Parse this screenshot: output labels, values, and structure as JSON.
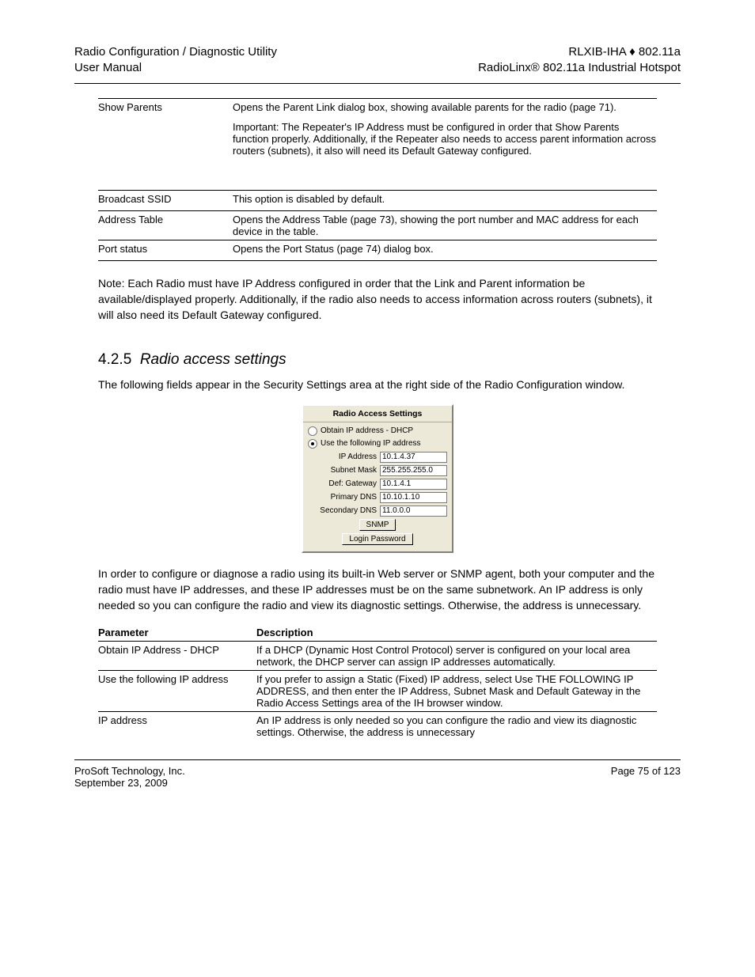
{
  "header": {
    "left_line1": "Radio Configuration / Diagnostic Utility",
    "left_line2": "User Manual",
    "right_line1": "RLXIB-IHA ♦ 802.11a",
    "right_line2": "RadioLinx® 802.11a Industrial Hotspot"
  },
  "table1": {
    "rows": [
      {
        "l": "Show Parents",
        "r": "Opens the Parent Link dialog box, showing available parents for the radio (page 71)."
      },
      {
        "l": "",
        "r": "Important: The Repeater's IP Address must be configured in order that Show Parents function properly. Additionally, if the Repeater also needs to access parent information across routers (subnets), it also will need its Default Gateway configured."
      },
      {
        "l": "Broadcast SSID",
        "r": "This option is disabled by default."
      },
      {
        "l": "Address Table",
        "r": "Opens the Address Table (page 73), showing the port number and MAC address for each device in the table."
      },
      {
        "l": "Port status",
        "r": "Opens the Port Status (page 74) dialog box."
      }
    ]
  },
  "note": "Note: Each Radio must have IP Address configured in order that the Link and Parent information be available/displayed properly. Additionally, if the radio also needs to access information across routers (subnets), it will also need its Default Gateway configured.",
  "section": {
    "number": "4.2.5",
    "title": "Radio access settings"
  },
  "body": "The following fields appear in the Security Settings area at the right side of the Radio Configuration window.",
  "dialog": {
    "title": "Radio Access Settings",
    "radio1": "Obtain IP address - DHCP",
    "radio2": "Use the following IP address",
    "fields": [
      {
        "label": "IP Address",
        "value": "10.1.4.37"
      },
      {
        "label": "Subnet Mask",
        "value": "255.255.255.0"
      },
      {
        "label": "Def: Gateway",
        "value": "10.1.4.1"
      },
      {
        "label": "Primary DNS",
        "value": "10.10.1.10"
      },
      {
        "label": "Secondary DNS",
        "value": "11.0.0.0"
      }
    ],
    "btn_snmp": "SNMP",
    "btn_login": "Login Password"
  },
  "body2": "In order to configure or diagnose a radio using its built-in Web server or SNMP agent, both your computer and the radio must have IP addresses, and these IP addresses must be on the same subnetwork. An IP address is only needed so you can configure the radio and view its diagnostic settings. Otherwise, the address is unnecessary.",
  "table2": {
    "hdr_l": "Parameter",
    "hdr_r": "Description",
    "rows": [
      {
        "l": "Obtain IP Address - DHCP",
        "r": "If a DHCP (Dynamic Host Control Protocol) server is configured on your local area network, the DHCP server can assign IP addresses automatically."
      },
      {
        "l": "Use the following IP address",
        "r": "If you prefer to assign a Static (Fixed) IP address, select Use THE FOLLOWING IP ADDRESS, and then enter the IP Address, Subnet Mask and Default Gateway in the Radio Access Settings area of the IH browser window."
      },
      {
        "l": "IP address",
        "r": "An IP address is only needed so you can configure the radio and view its diagnostic settings. Otherwise, the address is unnecessary"
      }
    ]
  },
  "footer": {
    "left_line1": "ProSoft Technology, Inc.",
    "left_line2": "September 23, 2009",
    "right_line1": "Page 75 of 123"
  }
}
